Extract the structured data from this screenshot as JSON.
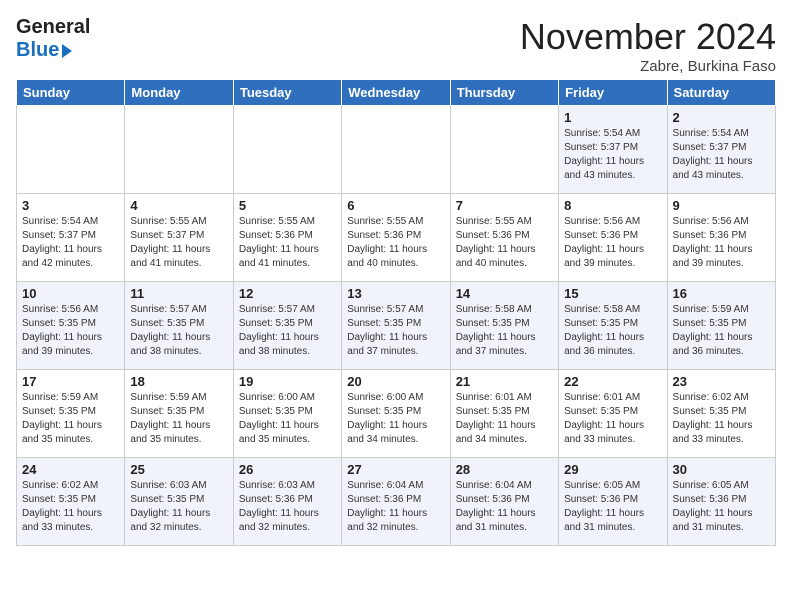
{
  "header": {
    "logo_line1": "General",
    "logo_line2": "Blue",
    "month_title": "November 2024",
    "subtitle": "Zabre, Burkina Faso"
  },
  "days_of_week": [
    "Sunday",
    "Monday",
    "Tuesday",
    "Wednesday",
    "Thursday",
    "Friday",
    "Saturday"
  ],
  "weeks": [
    [
      {
        "day": "",
        "info": ""
      },
      {
        "day": "",
        "info": ""
      },
      {
        "day": "",
        "info": ""
      },
      {
        "day": "",
        "info": ""
      },
      {
        "day": "",
        "info": ""
      },
      {
        "day": "1",
        "info": "Sunrise: 5:54 AM\nSunset: 5:37 PM\nDaylight: 11 hours\nand 43 minutes."
      },
      {
        "day": "2",
        "info": "Sunrise: 5:54 AM\nSunset: 5:37 PM\nDaylight: 11 hours\nand 43 minutes."
      }
    ],
    [
      {
        "day": "3",
        "info": "Sunrise: 5:54 AM\nSunset: 5:37 PM\nDaylight: 11 hours\nand 42 minutes."
      },
      {
        "day": "4",
        "info": "Sunrise: 5:55 AM\nSunset: 5:37 PM\nDaylight: 11 hours\nand 41 minutes."
      },
      {
        "day": "5",
        "info": "Sunrise: 5:55 AM\nSunset: 5:36 PM\nDaylight: 11 hours\nand 41 minutes."
      },
      {
        "day": "6",
        "info": "Sunrise: 5:55 AM\nSunset: 5:36 PM\nDaylight: 11 hours\nand 40 minutes."
      },
      {
        "day": "7",
        "info": "Sunrise: 5:55 AM\nSunset: 5:36 PM\nDaylight: 11 hours\nand 40 minutes."
      },
      {
        "day": "8",
        "info": "Sunrise: 5:56 AM\nSunset: 5:36 PM\nDaylight: 11 hours\nand 39 minutes."
      },
      {
        "day": "9",
        "info": "Sunrise: 5:56 AM\nSunset: 5:36 PM\nDaylight: 11 hours\nand 39 minutes."
      }
    ],
    [
      {
        "day": "10",
        "info": "Sunrise: 5:56 AM\nSunset: 5:35 PM\nDaylight: 11 hours\nand 39 minutes."
      },
      {
        "day": "11",
        "info": "Sunrise: 5:57 AM\nSunset: 5:35 PM\nDaylight: 11 hours\nand 38 minutes."
      },
      {
        "day": "12",
        "info": "Sunrise: 5:57 AM\nSunset: 5:35 PM\nDaylight: 11 hours\nand 38 minutes."
      },
      {
        "day": "13",
        "info": "Sunrise: 5:57 AM\nSunset: 5:35 PM\nDaylight: 11 hours\nand 37 minutes."
      },
      {
        "day": "14",
        "info": "Sunrise: 5:58 AM\nSunset: 5:35 PM\nDaylight: 11 hours\nand 37 minutes."
      },
      {
        "day": "15",
        "info": "Sunrise: 5:58 AM\nSunset: 5:35 PM\nDaylight: 11 hours\nand 36 minutes."
      },
      {
        "day": "16",
        "info": "Sunrise: 5:59 AM\nSunset: 5:35 PM\nDaylight: 11 hours\nand 36 minutes."
      }
    ],
    [
      {
        "day": "17",
        "info": "Sunrise: 5:59 AM\nSunset: 5:35 PM\nDaylight: 11 hours\nand 35 minutes."
      },
      {
        "day": "18",
        "info": "Sunrise: 5:59 AM\nSunset: 5:35 PM\nDaylight: 11 hours\nand 35 minutes."
      },
      {
        "day": "19",
        "info": "Sunrise: 6:00 AM\nSunset: 5:35 PM\nDaylight: 11 hours\nand 35 minutes."
      },
      {
        "day": "20",
        "info": "Sunrise: 6:00 AM\nSunset: 5:35 PM\nDaylight: 11 hours\nand 34 minutes."
      },
      {
        "day": "21",
        "info": "Sunrise: 6:01 AM\nSunset: 5:35 PM\nDaylight: 11 hours\nand 34 minutes."
      },
      {
        "day": "22",
        "info": "Sunrise: 6:01 AM\nSunset: 5:35 PM\nDaylight: 11 hours\nand 33 minutes."
      },
      {
        "day": "23",
        "info": "Sunrise: 6:02 AM\nSunset: 5:35 PM\nDaylight: 11 hours\nand 33 minutes."
      }
    ],
    [
      {
        "day": "24",
        "info": "Sunrise: 6:02 AM\nSunset: 5:35 PM\nDaylight: 11 hours\nand 33 minutes."
      },
      {
        "day": "25",
        "info": "Sunrise: 6:03 AM\nSunset: 5:35 PM\nDaylight: 11 hours\nand 32 minutes."
      },
      {
        "day": "26",
        "info": "Sunrise: 6:03 AM\nSunset: 5:36 PM\nDaylight: 11 hours\nand 32 minutes."
      },
      {
        "day": "27",
        "info": "Sunrise: 6:04 AM\nSunset: 5:36 PM\nDaylight: 11 hours\nand 32 minutes."
      },
      {
        "day": "28",
        "info": "Sunrise: 6:04 AM\nSunset: 5:36 PM\nDaylight: 11 hours\nand 31 minutes."
      },
      {
        "day": "29",
        "info": "Sunrise: 6:05 AM\nSunset: 5:36 PM\nDaylight: 11 hours\nand 31 minutes."
      },
      {
        "day": "30",
        "info": "Sunrise: 6:05 AM\nSunset: 5:36 PM\nDaylight: 11 hours\nand 31 minutes."
      }
    ]
  ]
}
